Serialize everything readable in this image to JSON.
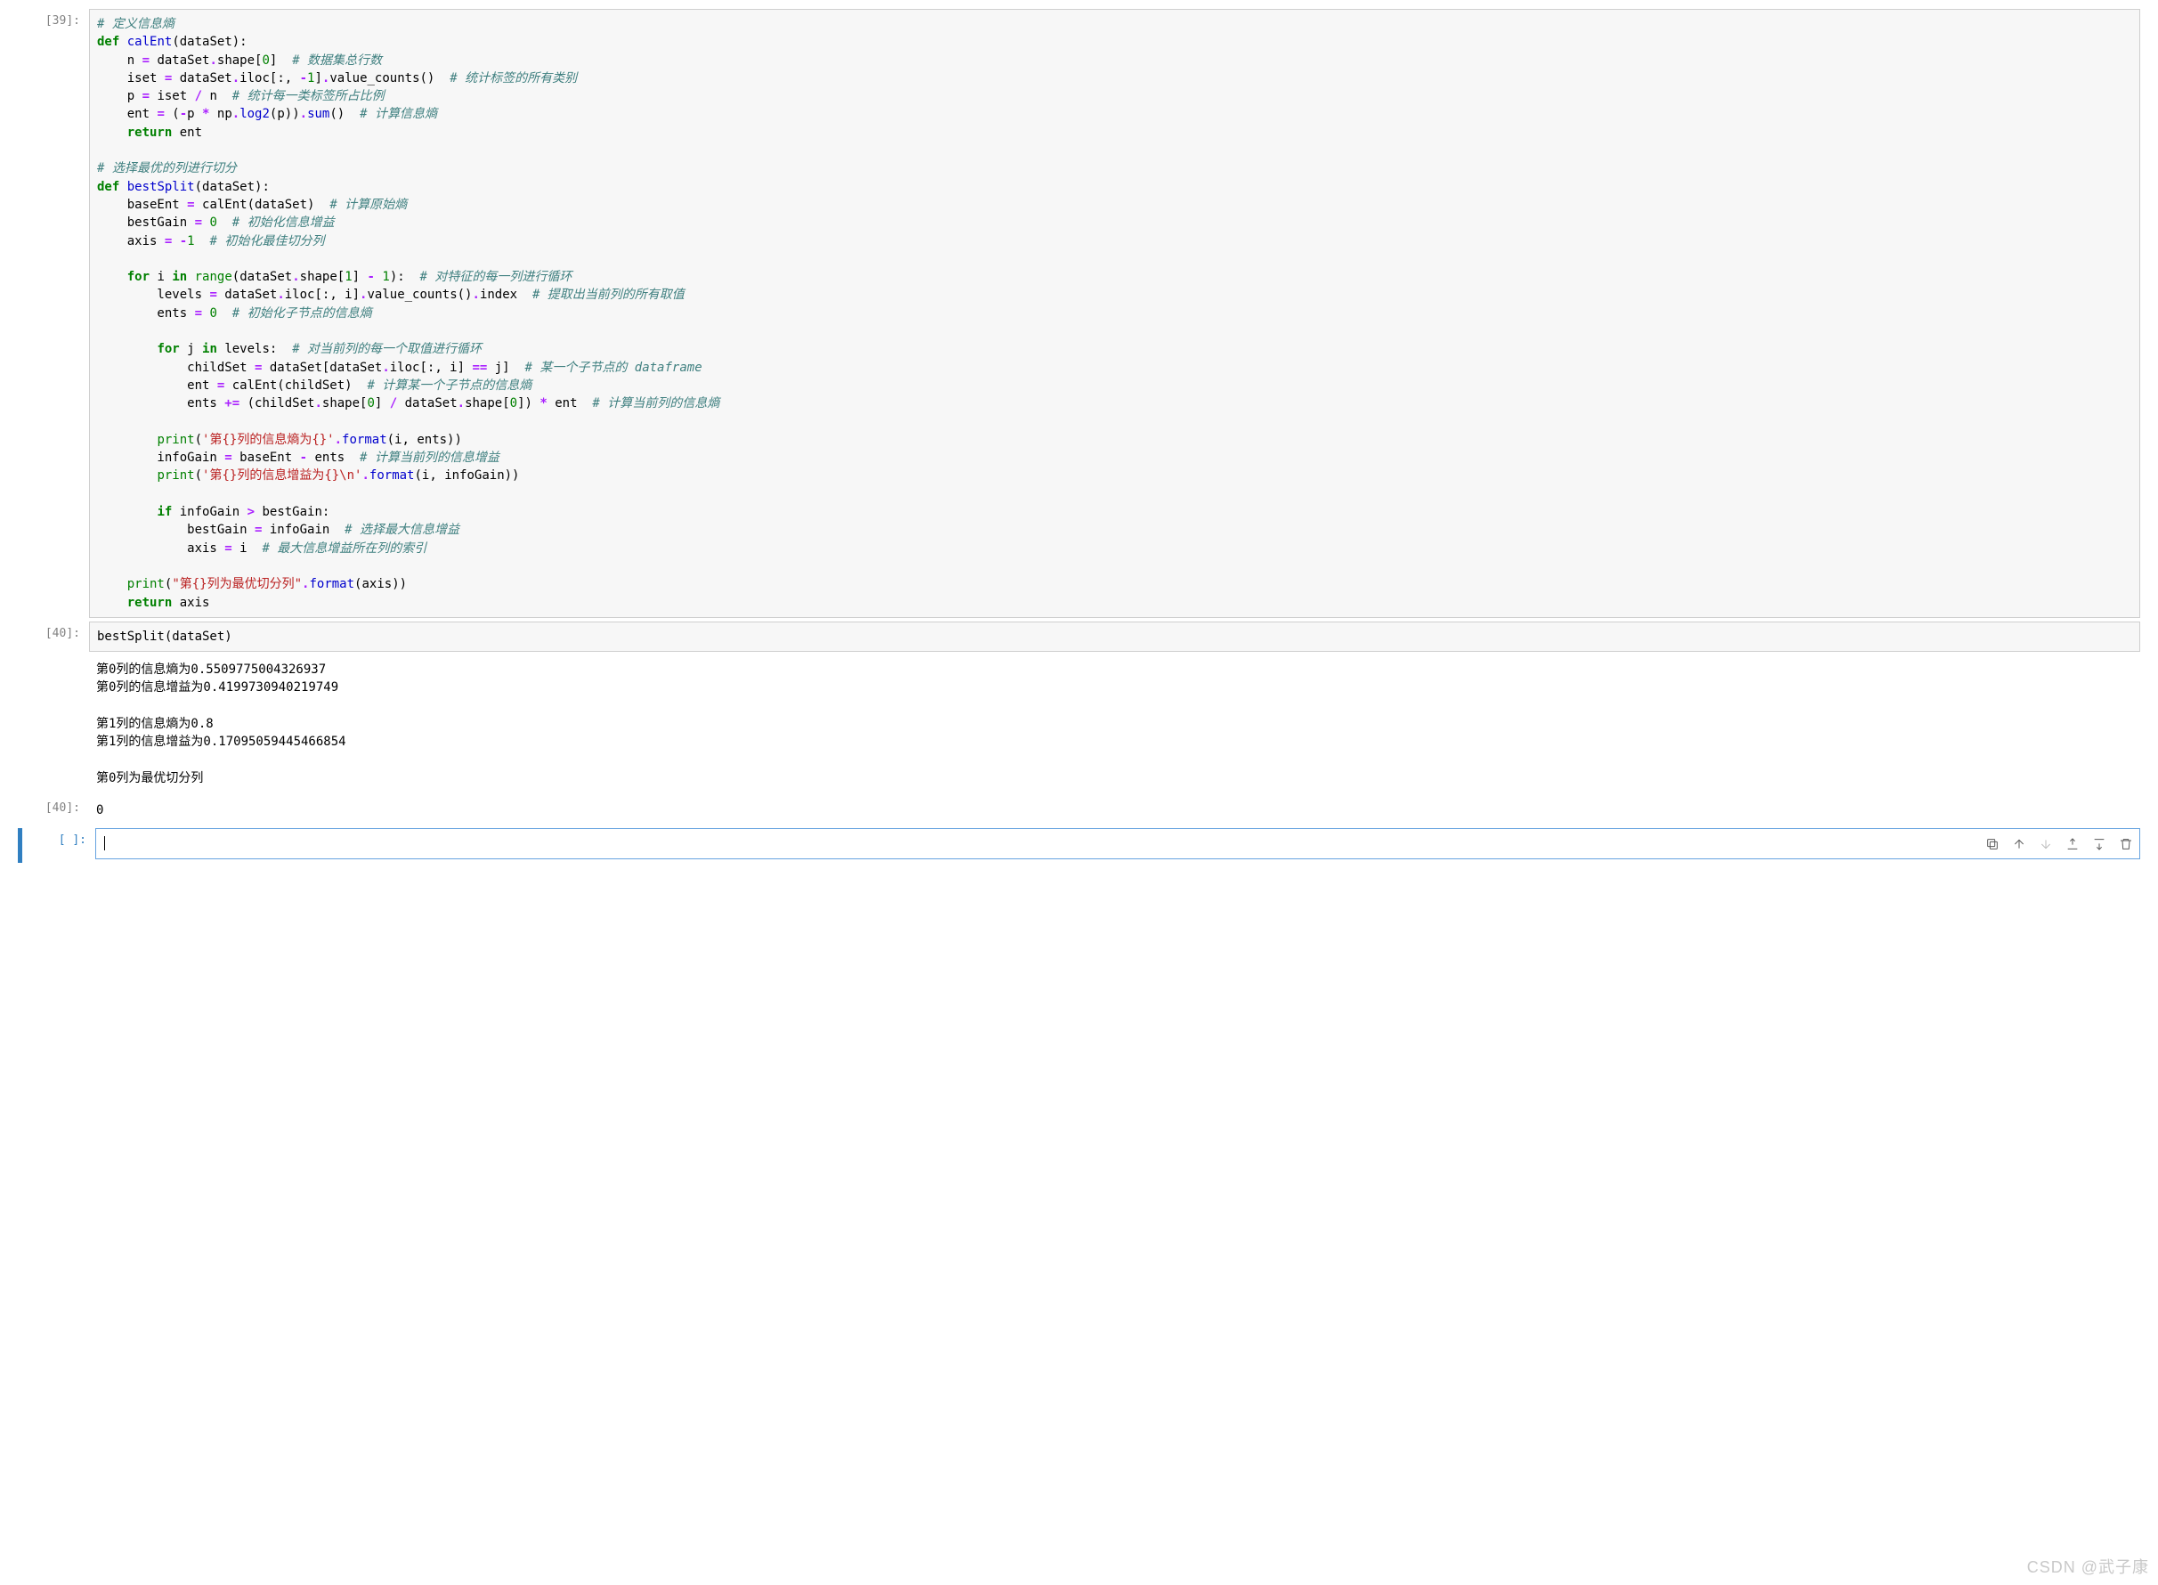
{
  "cells": {
    "c39": {
      "prompt": "[39]:",
      "code_tokens": [
        [
          "cm",
          "# 定义信息熵"
        ],
        [
          "nl",
          ""
        ],
        [
          "kw",
          "def"
        ],
        [
          "sp",
          " "
        ],
        [
          "fn",
          "calEnt"
        ],
        [
          "pl",
          "(dataSet):"
        ],
        [
          "nl",
          ""
        ],
        [
          "pl",
          "    n "
        ],
        [
          "op",
          "="
        ],
        [
          "pl",
          " dataSet"
        ],
        [
          "op",
          "."
        ],
        [
          "pl",
          "shape["
        ],
        [
          "num",
          "0"
        ],
        [
          "pl",
          "]  "
        ],
        [
          "cm",
          "# 数据集总行数"
        ],
        [
          "nl",
          ""
        ],
        [
          "pl",
          "    iset "
        ],
        [
          "op",
          "="
        ],
        [
          "pl",
          " dataSet"
        ],
        [
          "op",
          "."
        ],
        [
          "pl",
          "iloc[:, "
        ],
        [
          "op",
          "-"
        ],
        [
          "num",
          "1"
        ],
        [
          "pl",
          "]"
        ],
        [
          "op",
          "."
        ],
        [
          "pl",
          "value_counts()  "
        ],
        [
          "cm",
          "# 统计标签的所有类别"
        ],
        [
          "nl",
          ""
        ],
        [
          "pl",
          "    p "
        ],
        [
          "op",
          "="
        ],
        [
          "pl",
          " iset "
        ],
        [
          "op",
          "/"
        ],
        [
          "pl",
          " n  "
        ],
        [
          "cm",
          "# 统计每一类标签所占比例"
        ],
        [
          "nl",
          ""
        ],
        [
          "pl",
          "    ent "
        ],
        [
          "op",
          "="
        ],
        [
          "pl",
          " ("
        ],
        [
          "op",
          "-"
        ],
        [
          "pl",
          "p "
        ],
        [
          "op",
          "*"
        ],
        [
          "pl",
          " np"
        ],
        [
          "op",
          "."
        ],
        [
          "fn",
          "log2"
        ],
        [
          "pl",
          "(p))"
        ],
        [
          "op",
          "."
        ],
        [
          "fn",
          "sum"
        ],
        [
          "pl",
          "()  "
        ],
        [
          "cm",
          "# 计算信息熵"
        ],
        [
          "nl",
          ""
        ],
        [
          "pl",
          "    "
        ],
        [
          "kw",
          "return"
        ],
        [
          "pl",
          " ent"
        ],
        [
          "nl",
          ""
        ],
        [
          "nl",
          ""
        ],
        [
          "cm",
          "# 选择最优的列进行切分"
        ],
        [
          "nl",
          ""
        ],
        [
          "kw",
          "def"
        ],
        [
          "sp",
          " "
        ],
        [
          "fn",
          "bestSplit"
        ],
        [
          "pl",
          "(dataSet):"
        ],
        [
          "nl",
          ""
        ],
        [
          "pl",
          "    baseEnt "
        ],
        [
          "op",
          "="
        ],
        [
          "pl",
          " calEnt(dataSet)  "
        ],
        [
          "cm",
          "# 计算原始熵"
        ],
        [
          "nl",
          ""
        ],
        [
          "pl",
          "    bestGain "
        ],
        [
          "op",
          "="
        ],
        [
          "pl",
          " "
        ],
        [
          "num",
          "0"
        ],
        [
          "pl",
          "  "
        ],
        [
          "cm",
          "# 初始化信息增益"
        ],
        [
          "nl",
          ""
        ],
        [
          "pl",
          "    axis "
        ],
        [
          "op",
          "="
        ],
        [
          "pl",
          " "
        ],
        [
          "op",
          "-"
        ],
        [
          "num",
          "1"
        ],
        [
          "pl",
          "  "
        ],
        [
          "cm",
          "# 初始化最佳切分列"
        ],
        [
          "nl",
          ""
        ],
        [
          "nl",
          ""
        ],
        [
          "pl",
          "    "
        ],
        [
          "kw",
          "for"
        ],
        [
          "pl",
          " i "
        ],
        [
          "kw",
          "in"
        ],
        [
          "pl",
          " "
        ],
        [
          "bi",
          "range"
        ],
        [
          "pl",
          "(dataSet"
        ],
        [
          "op",
          "."
        ],
        [
          "pl",
          "shape["
        ],
        [
          "num",
          "1"
        ],
        [
          "pl",
          "] "
        ],
        [
          "op",
          "-"
        ],
        [
          "pl",
          " "
        ],
        [
          "num",
          "1"
        ],
        [
          "pl",
          "):  "
        ],
        [
          "cm",
          "# 对特征的每一列进行循环"
        ],
        [
          "nl",
          ""
        ],
        [
          "pl",
          "        levels "
        ],
        [
          "op",
          "="
        ],
        [
          "pl",
          " dataSet"
        ],
        [
          "op",
          "."
        ],
        [
          "pl",
          "iloc[:, i]"
        ],
        [
          "op",
          "."
        ],
        [
          "pl",
          "value_counts()"
        ],
        [
          "op",
          "."
        ],
        [
          "pl",
          "index  "
        ],
        [
          "cm",
          "# 提取出当前列的所有取值"
        ],
        [
          "nl",
          ""
        ],
        [
          "pl",
          "        ents "
        ],
        [
          "op",
          "="
        ],
        [
          "pl",
          " "
        ],
        [
          "num",
          "0"
        ],
        [
          "pl",
          "  "
        ],
        [
          "cm",
          "# 初始化子节点的信息熵"
        ],
        [
          "nl",
          ""
        ],
        [
          "nl",
          ""
        ],
        [
          "pl",
          "        "
        ],
        [
          "kw",
          "for"
        ],
        [
          "pl",
          " j "
        ],
        [
          "kw",
          "in"
        ],
        [
          "pl",
          " levels:  "
        ],
        [
          "cm",
          "# 对当前列的每一个取值进行循环"
        ],
        [
          "nl",
          ""
        ],
        [
          "pl",
          "            childSet "
        ],
        [
          "op",
          "="
        ],
        [
          "pl",
          " dataSet[dataSet"
        ],
        [
          "op",
          "."
        ],
        [
          "pl",
          "iloc[:, i] "
        ],
        [
          "op",
          "=="
        ],
        [
          "pl",
          " j]  "
        ],
        [
          "cm",
          "# 某一个子节点的 dataframe"
        ],
        [
          "nl",
          ""
        ],
        [
          "pl",
          "            ent "
        ],
        [
          "op",
          "="
        ],
        [
          "pl",
          " calEnt(childSet)  "
        ],
        [
          "cm",
          "# 计算某一个子节点的信息熵"
        ],
        [
          "nl",
          ""
        ],
        [
          "pl",
          "            ents "
        ],
        [
          "op",
          "+="
        ],
        [
          "pl",
          " (childSet"
        ],
        [
          "op",
          "."
        ],
        [
          "pl",
          "shape["
        ],
        [
          "num",
          "0"
        ],
        [
          "pl",
          "] "
        ],
        [
          "op",
          "/"
        ],
        [
          "pl",
          " dataSet"
        ],
        [
          "op",
          "."
        ],
        [
          "pl",
          "shape["
        ],
        [
          "num",
          "0"
        ],
        [
          "pl",
          "]) "
        ],
        [
          "op",
          "*"
        ],
        [
          "pl",
          " ent  "
        ],
        [
          "cm",
          "# 计算当前列的信息熵"
        ],
        [
          "nl",
          ""
        ],
        [
          "nl",
          ""
        ],
        [
          "pl",
          "        "
        ],
        [
          "bi",
          "print"
        ],
        [
          "pl",
          "("
        ],
        [
          "str",
          "'第{}列的信息熵为{}'"
        ],
        [
          "op",
          "."
        ],
        [
          "fn",
          "format"
        ],
        [
          "pl",
          "(i, ents))"
        ],
        [
          "nl",
          ""
        ],
        [
          "pl",
          "        infoGain "
        ],
        [
          "op",
          "="
        ],
        [
          "pl",
          " baseEnt "
        ],
        [
          "op",
          "-"
        ],
        [
          "pl",
          " ents  "
        ],
        [
          "cm",
          "# 计算当前列的信息增益"
        ],
        [
          "nl",
          ""
        ],
        [
          "pl",
          "        "
        ],
        [
          "bi",
          "print"
        ],
        [
          "pl",
          "("
        ],
        [
          "str",
          "'第{}列的信息增益为{}\\n'"
        ],
        [
          "op",
          "."
        ],
        [
          "fn",
          "format"
        ],
        [
          "pl",
          "(i, infoGain))"
        ],
        [
          "nl",
          ""
        ],
        [
          "nl",
          ""
        ],
        [
          "pl",
          "        "
        ],
        [
          "kw",
          "if"
        ],
        [
          "pl",
          " infoGain "
        ],
        [
          "op",
          ">"
        ],
        [
          "pl",
          " bestGain:"
        ],
        [
          "nl",
          ""
        ],
        [
          "pl",
          "            bestGain "
        ],
        [
          "op",
          "="
        ],
        [
          "pl",
          " infoGain  "
        ],
        [
          "cm",
          "# 选择最大信息增益"
        ],
        [
          "nl",
          ""
        ],
        [
          "pl",
          "            axis "
        ],
        [
          "op",
          "="
        ],
        [
          "pl",
          " i  "
        ],
        [
          "cm",
          "# 最大信息增益所在列的索引"
        ],
        [
          "nl",
          ""
        ],
        [
          "nl",
          ""
        ],
        [
          "pl",
          "    "
        ],
        [
          "bi",
          "print"
        ],
        [
          "pl",
          "("
        ],
        [
          "str",
          "\"第{}列为最优切分列\""
        ],
        [
          "op",
          "."
        ],
        [
          "fn",
          "format"
        ],
        [
          "pl",
          "(axis))"
        ],
        [
          "nl",
          ""
        ],
        [
          "pl",
          "    "
        ],
        [
          "kw",
          "return"
        ],
        [
          "pl",
          " axis"
        ]
      ]
    },
    "c40": {
      "prompt": "[40]:",
      "code": "bestSplit(dataSet)",
      "output_lines": [
        "第0列的信息熵为0.5509775004326937",
        "第0列的信息增益为0.4199730940219749",
        "",
        "第1列的信息熵为0.8",
        "第1列的信息增益为0.17095059445466854",
        "",
        "第0列为最优切分列"
      ],
      "result_prompt": "[40]:",
      "result": "0"
    },
    "empty": {
      "prompt": "[ ]:"
    }
  },
  "watermark": "CSDN @武子康"
}
